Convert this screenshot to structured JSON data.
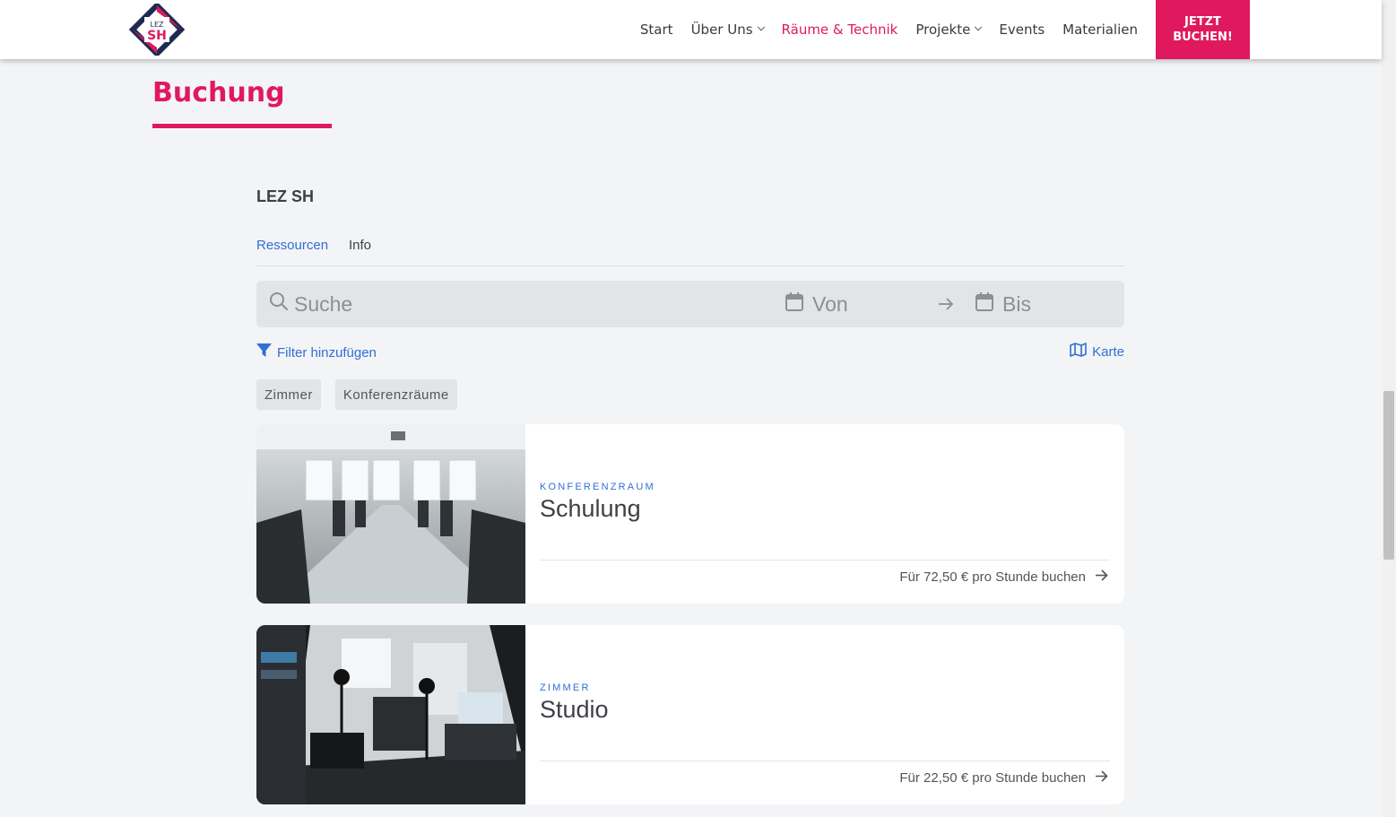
{
  "header": {
    "logo_letters_top": "LEZ",
    "logo_letters_bottom": "SH",
    "nav": [
      {
        "label": "Start",
        "dropdown": false,
        "active": false
      },
      {
        "label": "Über Uns",
        "dropdown": true,
        "active": false
      },
      {
        "label": "Räume & Technik",
        "dropdown": false,
        "active": true
      },
      {
        "label": "Projekte",
        "dropdown": true,
        "active": false
      },
      {
        "label": "Events",
        "dropdown": false,
        "active": false
      },
      {
        "label": "Materialien",
        "dropdown": false,
        "active": false
      }
    ],
    "cta_line1": "JETZT",
    "cta_line2": "BUCHEN!"
  },
  "page": {
    "title": "Buchung"
  },
  "booking": {
    "org_name": "LEZ SH",
    "tabs": [
      {
        "label": "Ressourcen",
        "active": true
      },
      {
        "label": "Info",
        "active": false
      }
    ],
    "search_placeholder": "Suche",
    "from_placeholder": "Von",
    "to_placeholder": "Bis",
    "filter_label": "Filter hinzufügen",
    "map_label": "Karte",
    "chips": [
      "Zimmer",
      "Konferenzräume"
    ],
    "resources": [
      {
        "type": "KONFERENZRAUM",
        "name": "Schulung",
        "price_text": "Für 72,50 € pro Stunde buchen"
      },
      {
        "type": "ZIMMER",
        "name": "Studio",
        "price_text": "Für 22,50 € pro Stunde buchen"
      }
    ]
  },
  "colors": {
    "brand_pink": "#e0195e",
    "link_blue": "#2f6fd6",
    "logo_navy": "#1e2a52"
  }
}
